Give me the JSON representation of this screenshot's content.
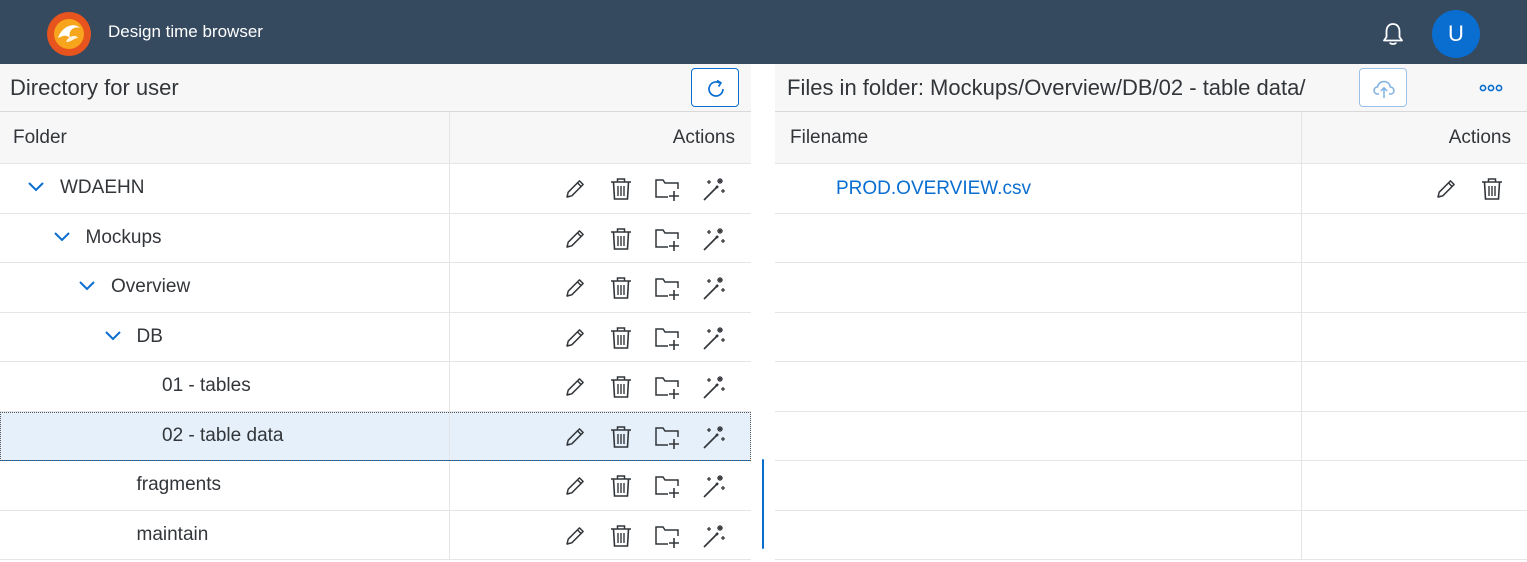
{
  "shell": {
    "app_title": "Design time browser",
    "avatar_initial": "U",
    "colors": {
      "bar": "#354a5f",
      "accent": "#0a6ed1"
    }
  },
  "left": {
    "title": "Directory for user",
    "columns": {
      "folder": "Folder",
      "actions": "Actions"
    },
    "rows": [
      {
        "label": "WDAEHN",
        "expanded": true,
        "selected": false
      },
      {
        "label": "Mockups",
        "expanded": true,
        "selected": false
      },
      {
        "label": "Overview",
        "expanded": true,
        "selected": false
      },
      {
        "label": "DB",
        "expanded": true,
        "selected": false
      },
      {
        "label": "01 - tables",
        "expanded": false,
        "selected": false
      },
      {
        "label": "02 - table data",
        "expanded": false,
        "selected": true
      },
      {
        "label": "fragments",
        "expanded": false,
        "selected": false
      },
      {
        "label": "maintain",
        "expanded": false,
        "selected": false
      }
    ]
  },
  "right": {
    "title": "Files in folder: Mockups/Overview/DB/02 - table data/",
    "columns": {
      "filename": "Filename",
      "actions": "Actions"
    },
    "files": [
      {
        "name": "PROD.OVERVIEW.csv"
      }
    ]
  },
  "icons": {
    "refresh": "refresh-icon",
    "upload": "cloud-upload-icon",
    "more": "overflow-icon",
    "edit": "pencil-icon",
    "delete": "trash-icon",
    "new_folder": "add-folder-icon",
    "generate": "magic-wand-icon",
    "expand": "chevron-down-icon",
    "notifications": "bell-icon"
  }
}
